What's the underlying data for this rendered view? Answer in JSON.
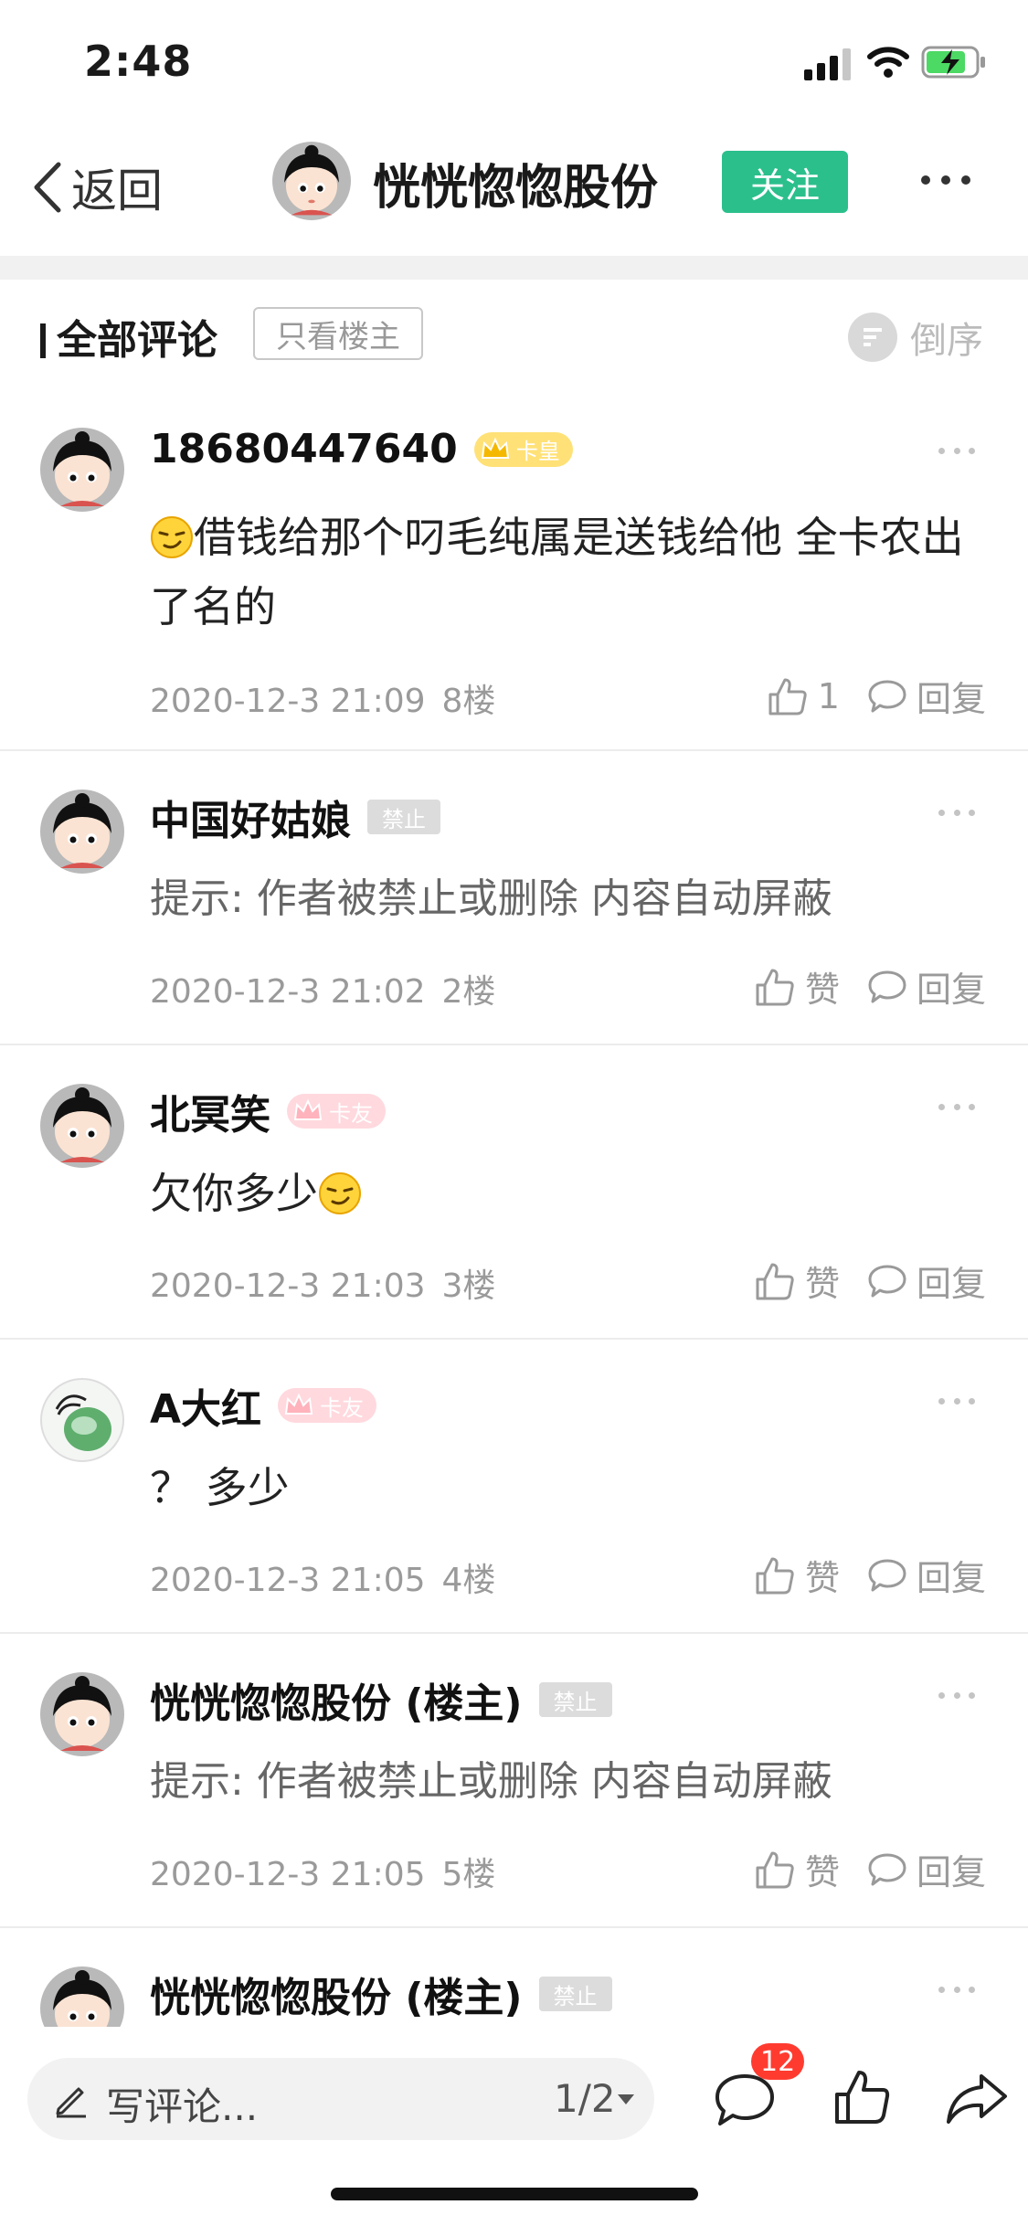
{
  "status_bar": {
    "time": "2:48"
  },
  "nav": {
    "back_label": "返回",
    "title": "恍恍惚惚股份",
    "follow_label": "关注"
  },
  "comment_header": {
    "title": "全部评论",
    "only_owner_label": "只看楼主",
    "sort_label": "倒序"
  },
  "comments": [
    {
      "name": "18680447640",
      "badge": "卡皇",
      "badge_type": "king",
      "text": "借钱给那个叼毛纯属是送钱给他 全卡农出了名的",
      "has_emoji": true,
      "date": "2020-12-3 21:09",
      "floor": "8楼",
      "like": "1",
      "reply": "回复"
    },
    {
      "name": "中国好姑娘",
      "badge": "禁止",
      "badge_type": "ban",
      "text": "提示: 作者被禁止或删除 内容自动屏蔽",
      "date": "2020-12-3 21:02",
      "floor": "2楼",
      "like": "赞",
      "reply": "回复"
    },
    {
      "name": "北冥笑",
      "badge": "卡友",
      "badge_type": "friend",
      "text": "欠你多少",
      "has_emoji_after": true,
      "date": "2020-12-3 21:03",
      "floor": "3楼",
      "like": "赞",
      "reply": "回复"
    },
    {
      "name": "A大红",
      "badge": "卡友",
      "badge_type": "friend",
      "text": "？ 多少",
      "date": "2020-12-3 21:05",
      "floor": "4楼",
      "like": "赞",
      "reply": "回复"
    },
    {
      "name": "恍恍惚惚股份 (楼主)",
      "badge": "禁止",
      "badge_type": "ban",
      "text": "提示: 作者被禁止或删除 内容自动屏蔽",
      "date": "2020-12-3 21:05",
      "floor": "5楼",
      "like": "赞",
      "reply": "回复"
    },
    {
      "name": "恍恍惚惚股份 (楼主)",
      "badge": "禁止",
      "badge_type": "ban"
    }
  ],
  "bottom_bar": {
    "write_label": "写评论...",
    "page_indicator": "1/2",
    "comment_count": "12"
  },
  "colors": {
    "accent_green": "#2bbf8c",
    "badge_red": "#ff3b30"
  },
  "icons": [
    "back-chevron-icon",
    "more-icon",
    "sort-icon",
    "crown-icon",
    "thumbs-up-icon",
    "comment-bubble-icon",
    "pencil-icon",
    "share-icon",
    "smirk-emoji-icon"
  ]
}
